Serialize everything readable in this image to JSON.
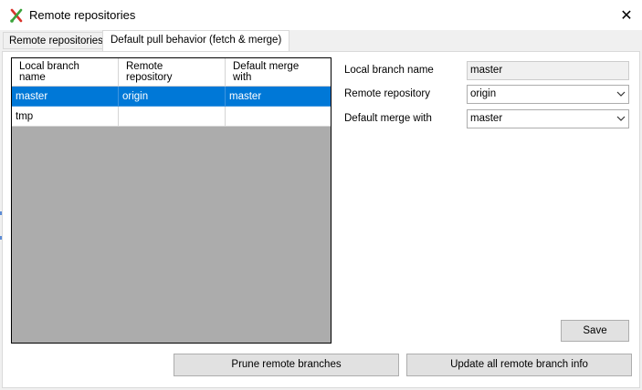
{
  "window": {
    "title": "Remote repositories",
    "close_glyph": "✕",
    "app_icon": "git-extensions-icon"
  },
  "tabs": [
    {
      "label": "Remote repositories",
      "active": false
    },
    {
      "label": "Default pull behavior (fetch & merge)",
      "active": true
    }
  ],
  "grid": {
    "headers": [
      "Local branch\nname",
      "Remote\nrepository",
      "Default merge\nwith"
    ],
    "header_lines": [
      [
        "Local branch",
        "name"
      ],
      [
        "Remote",
        "repository"
      ],
      [
        "Default merge",
        "with"
      ]
    ],
    "rows": [
      {
        "local": "master",
        "remote": "origin",
        "merge": "master",
        "selected": true
      },
      {
        "local": "tmp",
        "remote": "",
        "merge": "",
        "selected": false
      }
    ]
  },
  "form": {
    "local_branch_label": "Local branch name",
    "local_branch_value": "master",
    "remote_repo_label": "Remote repository",
    "remote_repo_value": "origin",
    "merge_with_label": "Default merge with",
    "merge_with_value": "master"
  },
  "buttons": {
    "save": "Save",
    "prune": "Prune remote branches",
    "update_all": "Update all remote branch info"
  },
  "colors": {
    "selection": "#0078d7",
    "grid_empty": "#acacac"
  }
}
